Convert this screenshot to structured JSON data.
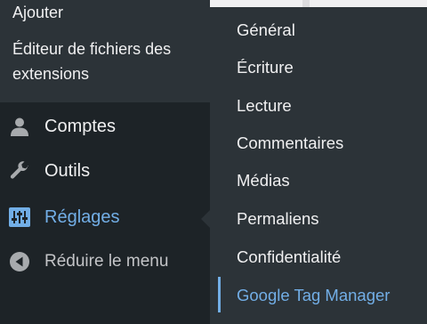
{
  "previous_submenu": {
    "items": [
      {
        "label": "Ajouter"
      },
      {
        "label": "Éditeur de fichiers des extensions"
      }
    ]
  },
  "menu": {
    "items": [
      {
        "label": "Comptes",
        "icon": "user-icon"
      },
      {
        "label": "Outils",
        "icon": "wrench-icon"
      },
      {
        "label": "Réglages",
        "icon": "settings-sliders-icon",
        "active": true
      },
      {
        "label": "Réduire le menu",
        "icon": "collapse-arrow-icon"
      }
    ]
  },
  "flyout": {
    "items": [
      {
        "label": "Général"
      },
      {
        "label": "Écriture"
      },
      {
        "label": "Lecture"
      },
      {
        "label": "Commentaires"
      },
      {
        "label": "Médias"
      },
      {
        "label": "Permaliens"
      },
      {
        "label": "Confidentialité"
      },
      {
        "label": "Google Tag Manager",
        "current": true
      }
    ]
  },
  "colors": {
    "menu_bg": "#1d2327",
    "submenu_bg": "#2c3338",
    "text": "#f0f0f1",
    "accent": "#72aee6",
    "muted_icon": "#a7aaad"
  }
}
